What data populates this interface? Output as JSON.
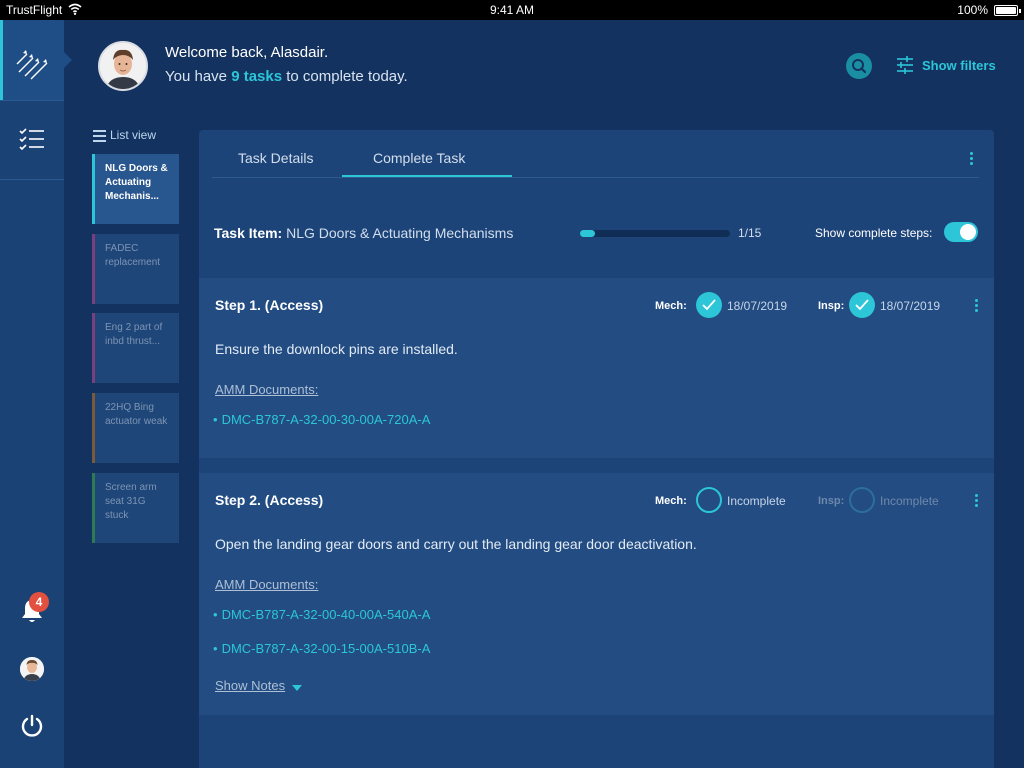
{
  "status_bar": {
    "carrier": "TrustFlight",
    "time": "9:41 AM",
    "battery": "100%"
  },
  "header": {
    "welcome": "Welcome back, Alasdair.",
    "tasks_prefix": "You have ",
    "tasks_count": "9 tasks",
    "tasks_suffix": " to complete today.",
    "show_filters": "Show filters"
  },
  "rail": {
    "notification_count": "4"
  },
  "list": {
    "view_label": "List view",
    "items": [
      {
        "label": "NLG Doors & Actuating Mechanis...",
        "accent": "#2cc6d8"
      },
      {
        "label": "FADEC replacement",
        "accent": "#7a3f7d"
      },
      {
        "label": "Eng 2 part of inbd thrust...",
        "accent": "#7a3f7d"
      },
      {
        "label": "22HQ Bing actuator weak",
        "accent": "#7b5a3b"
      },
      {
        "label": "Screen arm seat 31G stuck",
        "accent": "#2d7a55"
      }
    ]
  },
  "panel": {
    "tabs": [
      "Task Details",
      "Complete Task"
    ],
    "active_tab": 1,
    "task_item_label": "Task Item:",
    "task_item_name": "NLG Doors & Actuating Mechanisms",
    "progress_fraction": 0.0667,
    "progress_text": "1/15",
    "show_complete_label": "Show complete steps:",
    "show_complete_on": true,
    "steps": [
      {
        "title": "Step 1. (Access)",
        "mech_label": "Mech:",
        "mech_value": "18/07/2019",
        "insp_label": "Insp:",
        "insp_value": "18/07/2019",
        "description": "Ensure the downlock pins are installed.",
        "amm_label": "AMM Documents:",
        "documents": [
          "DMC-B787-A-32-00-30-00A-720A-A"
        ]
      },
      {
        "title": "Step 2. (Access)",
        "mech_label": "Mech:",
        "mech_value": "Incomplete",
        "insp_label": "Insp:",
        "insp_value": "Incomplete",
        "description": "Open the landing gear doors and carry out the landing gear door deactivation.",
        "amm_label": "AMM Documents:",
        "documents": [
          "DMC-B787-A-32-00-40-00A-540A-A",
          "DMC-B787-A-32-00-15-00A-510B-A"
        ],
        "show_notes": "Show Notes"
      }
    ]
  },
  "colors": {
    "accent": "#2cc6d8",
    "background": "#13325f",
    "panel": "#1d4478",
    "badge": "#e2503f"
  },
  "icons": [
    "wifi-icon",
    "logo-icon",
    "tasks-icon",
    "bell-icon",
    "power-icon",
    "search-icon",
    "filters-icon",
    "list-icon",
    "check-icon",
    "kebab-icon",
    "caret-down-icon"
  ]
}
